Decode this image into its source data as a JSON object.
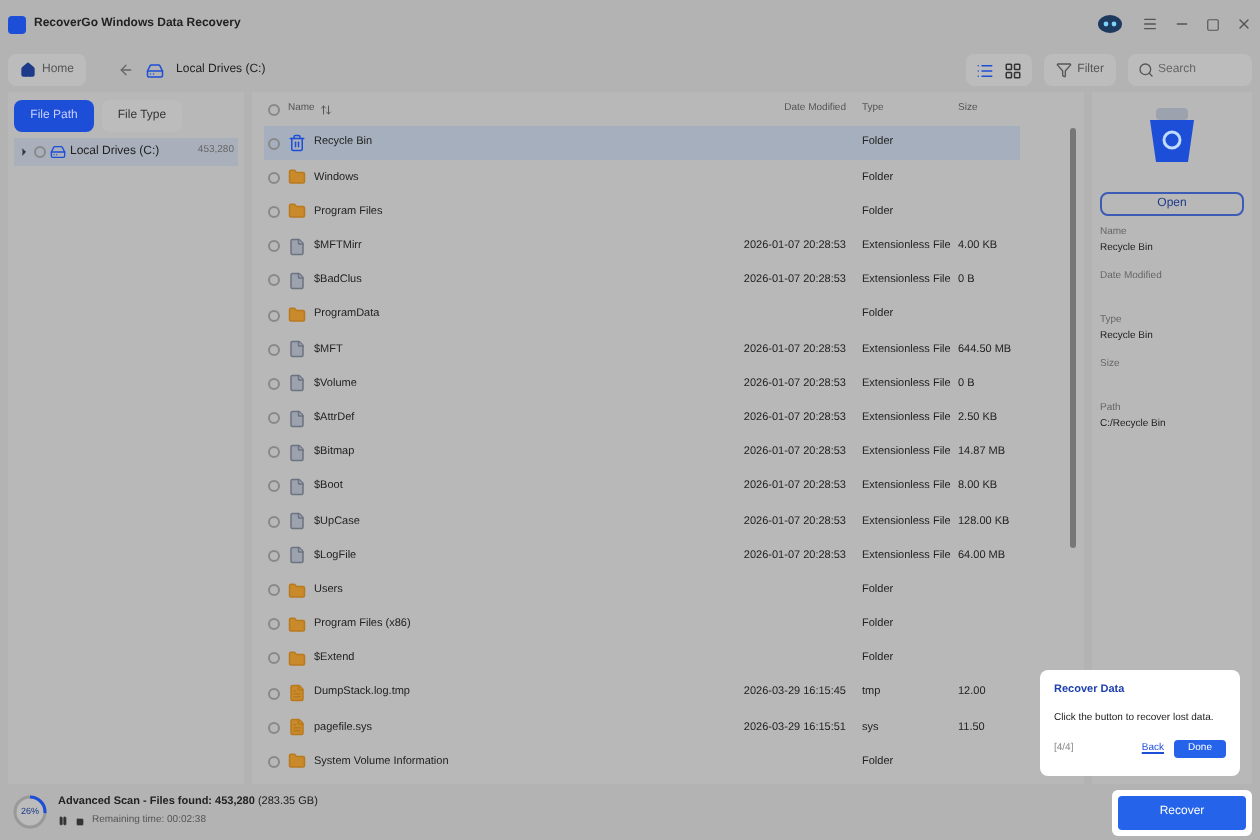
{
  "window": {
    "title": "RecoverGo Windows Data Recovery"
  },
  "toolbar": {
    "home": "Home",
    "path": "Local Drives (C:)",
    "filter": "Filter",
    "search": {
      "placeholder": "Search"
    },
    "view": [
      {
        "kind": "list",
        "selected": true
      },
      {
        "kind": "grid",
        "selected": false
      }
    ]
  },
  "sidebar": {
    "tabs": [
      {
        "label": "File Path",
        "selected": true
      },
      {
        "label": "File Type",
        "selected": false
      }
    ],
    "items": [
      {
        "label": "Local Drives (C:)",
        "count": "453,280",
        "selected": true,
        "checked": false
      }
    ]
  },
  "table": {
    "all_checked": false,
    "columns": [
      "Name",
      "Date Modified",
      "Type",
      "Size"
    ],
    "rows": [
      {
        "kind": "bin",
        "name": "Recycle Bin",
        "type": "Folder",
        "selected": true
      },
      {
        "kind": "folder",
        "name": "Windows",
        "type": "Folder",
        "selected": false
      },
      {
        "kind": "folder",
        "name": "Program Files",
        "type": "Folder",
        "selected": false
      },
      {
        "kind": "file",
        "name": "$MFTMirr",
        "date": "2026-01-07 20:28:53",
        "type": "Extensionless File",
        "size": "4.00 KB",
        "selected": false
      },
      {
        "kind": "file",
        "name": "$BadClus",
        "date": "2026-01-07 20:28:53",
        "type": "Extensionless File",
        "size": "0 B",
        "selected": false
      },
      {
        "kind": "folder",
        "name": "ProgramData",
        "type": "Folder",
        "selected": false
      },
      {
        "kind": "file",
        "name": "$MFT",
        "date": "2026-01-07 20:28:53",
        "type": "Extensionless File",
        "size": "644.50 MB",
        "selected": false
      },
      {
        "kind": "file",
        "name": "$Volume",
        "date": "2026-01-07 20:28:53",
        "type": "Extensionless File",
        "size": "0 B",
        "selected": false
      },
      {
        "kind": "file",
        "name": "$AttrDef",
        "date": "2026-01-07 20:28:53",
        "type": "Extensionless File",
        "size": "2.50 KB",
        "selected": false
      },
      {
        "kind": "file",
        "name": "$Bitmap",
        "date": "2026-01-07 20:28:53",
        "type": "Extensionless File",
        "size": "14.87 MB",
        "selected": false
      },
      {
        "kind": "file",
        "name": "$Boot",
        "date": "2026-01-07 20:28:53",
        "type": "Extensionless File",
        "size": "8.00 KB",
        "selected": false
      },
      {
        "kind": "file",
        "name": "$UpCase",
        "date": "2026-01-07 20:28:53",
        "type": "Extensionless File",
        "size": "128.00 KB",
        "selected": false
      },
      {
        "kind": "file",
        "name": "$LogFile",
        "date": "2026-01-07 20:28:53",
        "type": "Extensionless File",
        "size": "64.00 MB",
        "selected": false
      },
      {
        "kind": "folder",
        "name": "Users",
        "type": "Folder",
        "selected": false
      },
      {
        "kind": "folder",
        "name": "Program Files (x86)",
        "type": "Folder",
        "selected": false
      },
      {
        "kind": "folder",
        "name": "$Extend",
        "type": "Folder",
        "selected": false
      },
      {
        "kind": "doc",
        "name": "DumpStack.log.tmp",
        "date": "2026-03-29 16:15:45",
        "type": "tmp",
        "size": "12.00",
        "selected": false
      },
      {
        "kind": "doc",
        "name": "pagefile.sys",
        "date": "2026-03-29 16:15:51",
        "type": "sys",
        "size": "11.50",
        "selected": false
      },
      {
        "kind": "folder",
        "name": "System Volume Information",
        "type": "Folder",
        "selected": false
      }
    ]
  },
  "details": {
    "open": "Open",
    "fields": [
      {
        "label": "Name",
        "value": "Recycle Bin"
      },
      {
        "label": "Date Modified"
      },
      {
        "label": "Type",
        "value": "Recycle Bin"
      },
      {
        "label": "Size"
      },
      {
        "label": "Path",
        "value": "C:/Recycle Bin"
      }
    ]
  },
  "status_bar": {
    "progress": "26%",
    "level": 0.26,
    "scan": "**Advanced Scan - Files found: 453,280** (283.35 GB)",
    "remaining": "Remaining time: 00:02:38",
    "recover": "Recover"
  },
  "popover": {
    "title": "Recover Data",
    "text": "Click the button to recover lost data.",
    "step": "[4/4]",
    "back": "Back",
    "done": "Done"
  }
}
